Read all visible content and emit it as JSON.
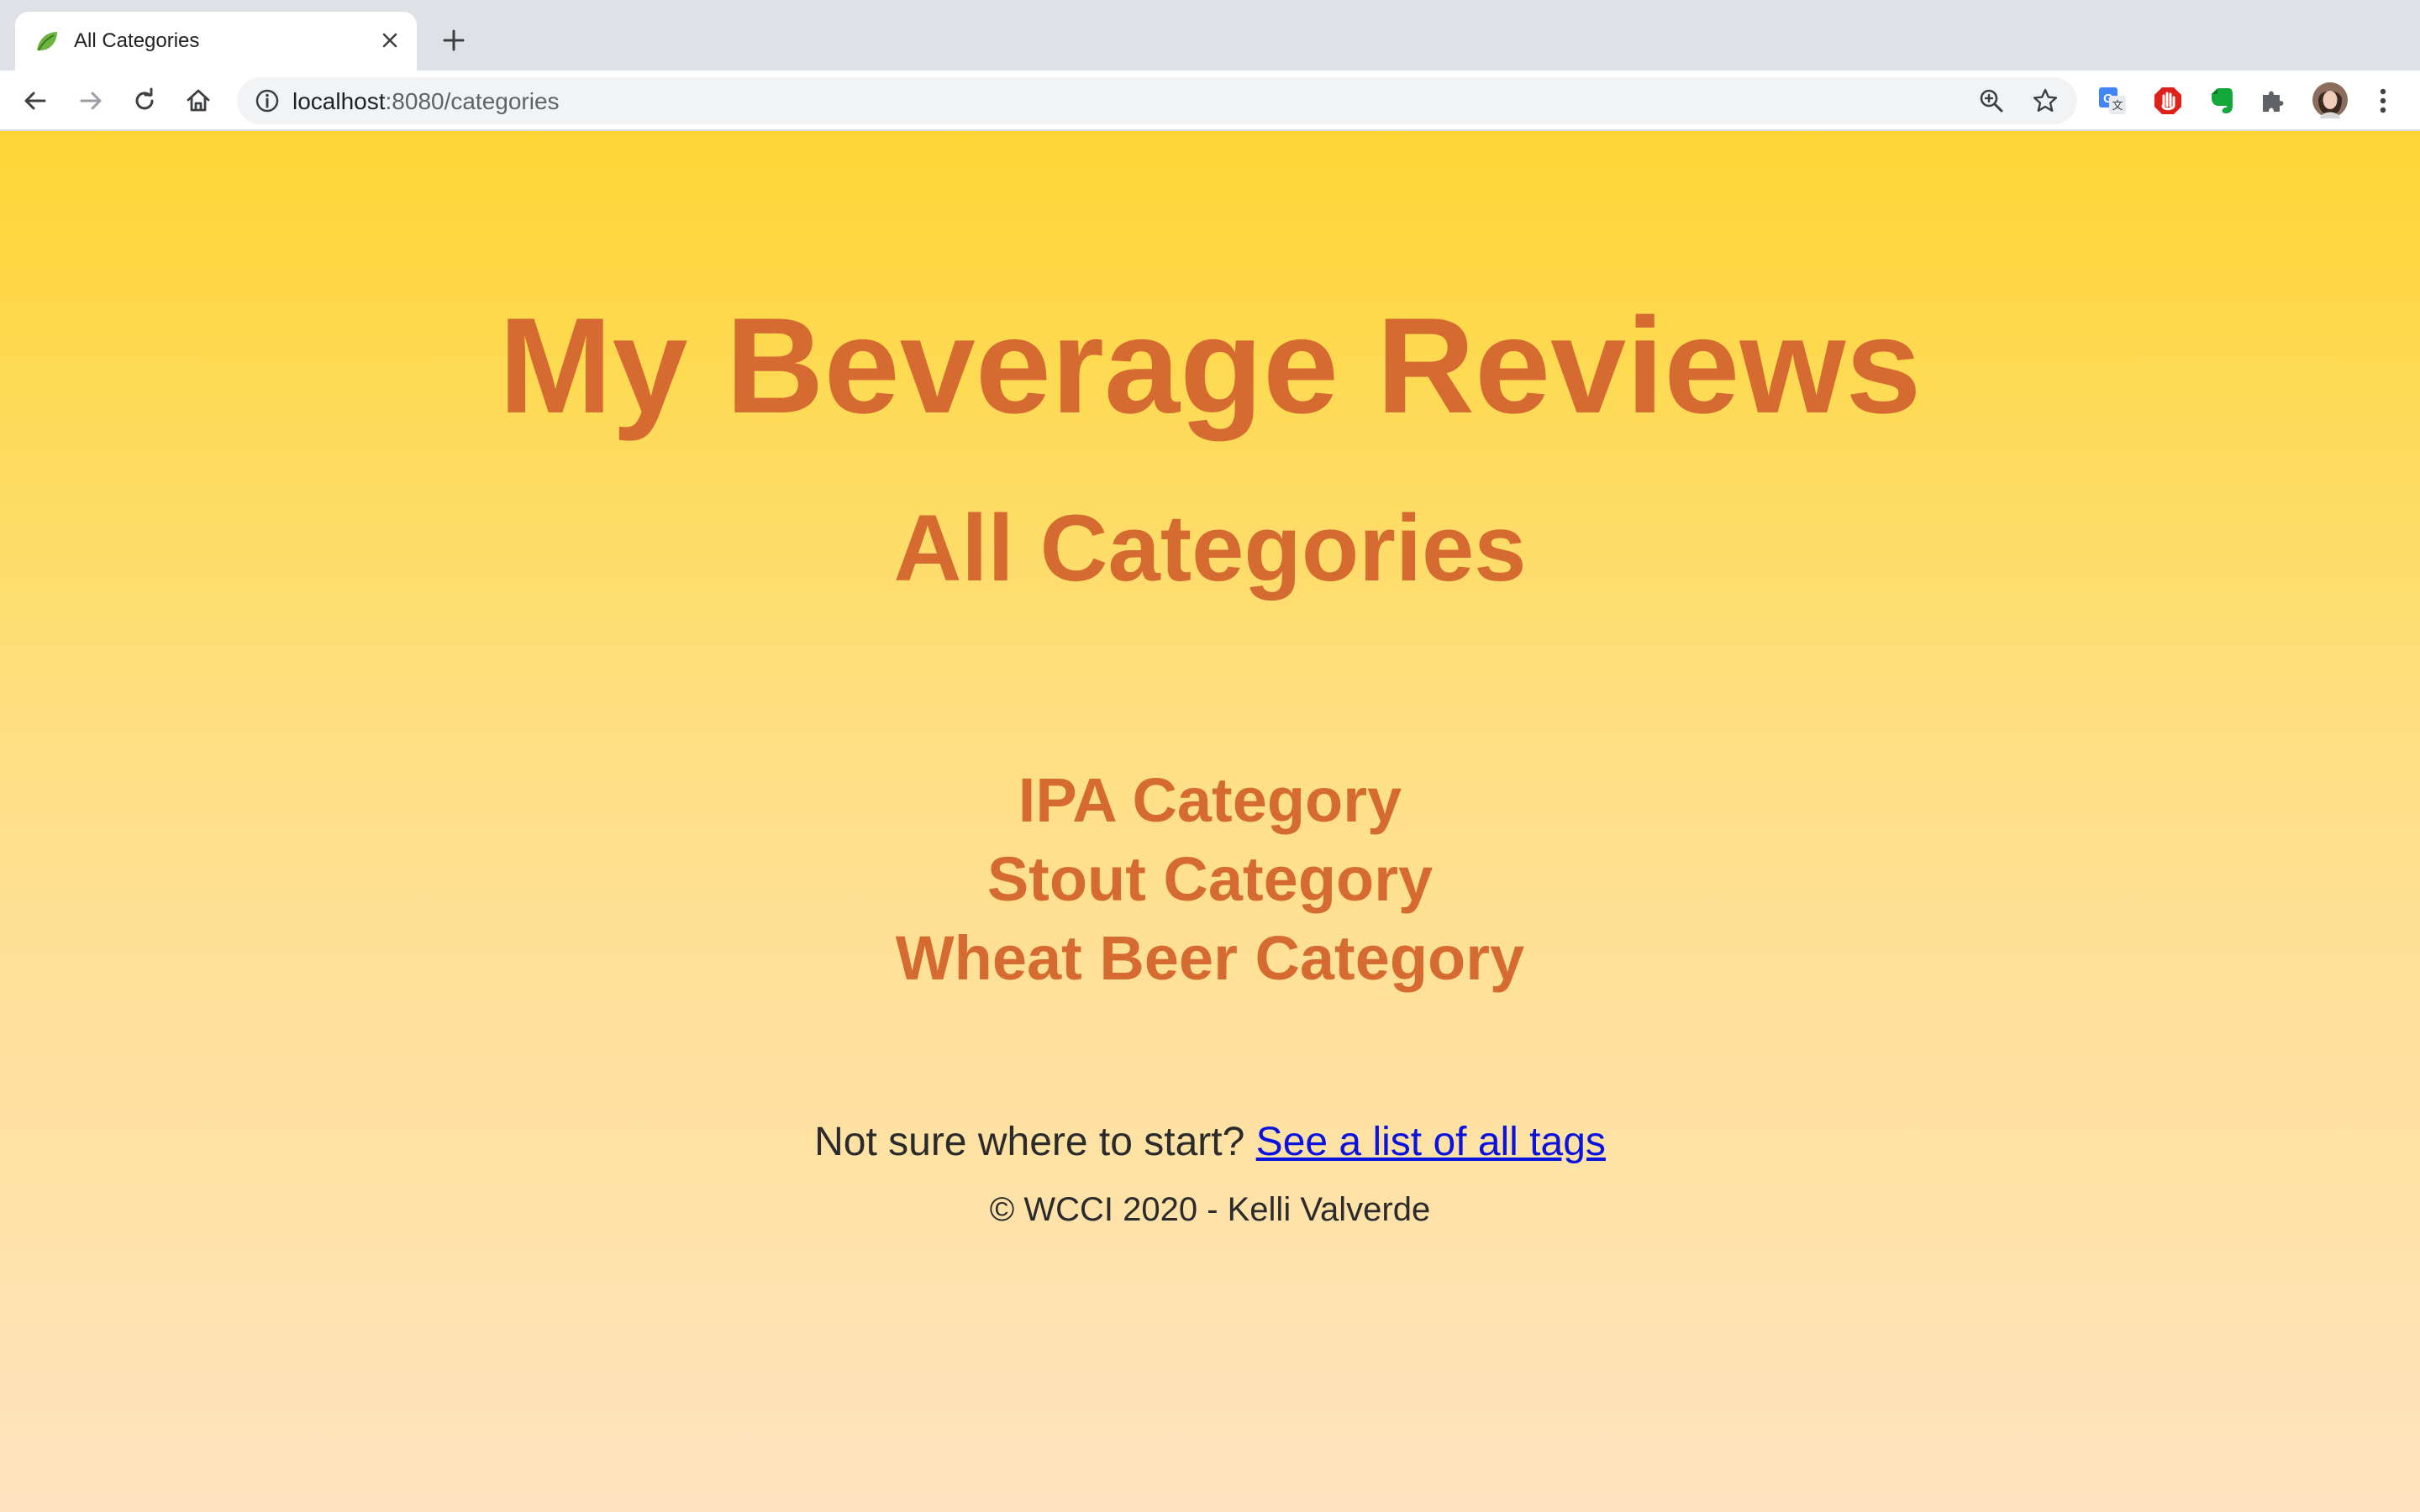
{
  "browser": {
    "tab": {
      "title": "All Categories",
      "favicon": "spring-leaf-icon"
    },
    "new_tab": "plus-icon",
    "address_bar": {
      "host": "localhost",
      "rest": ":8080/categories"
    },
    "extensions": [
      "translate-icon",
      "adblock-icon",
      "evernote-icon",
      "puzzle-icon"
    ],
    "colors": {
      "tabstrip": "#dee1e6",
      "omnibox": "#f1f3f4"
    }
  },
  "page": {
    "site_title": "My Beverage Reviews",
    "heading": "All Categories",
    "categories": [
      {
        "label": "IPA Category"
      },
      {
        "label": "Stout Category"
      },
      {
        "label": "Wheat Beer Category"
      }
    ],
    "tags_prompt": "Not sure where to start?",
    "tags_link": "See a list of all tags",
    "footer": "© WCCI 2020 - Kelli Valverde",
    "colors": {
      "accent": "#d56b31",
      "gradient_top": "#fed634",
      "gradient_bottom": "#ffe3bf",
      "link": "#0a12e0"
    }
  }
}
